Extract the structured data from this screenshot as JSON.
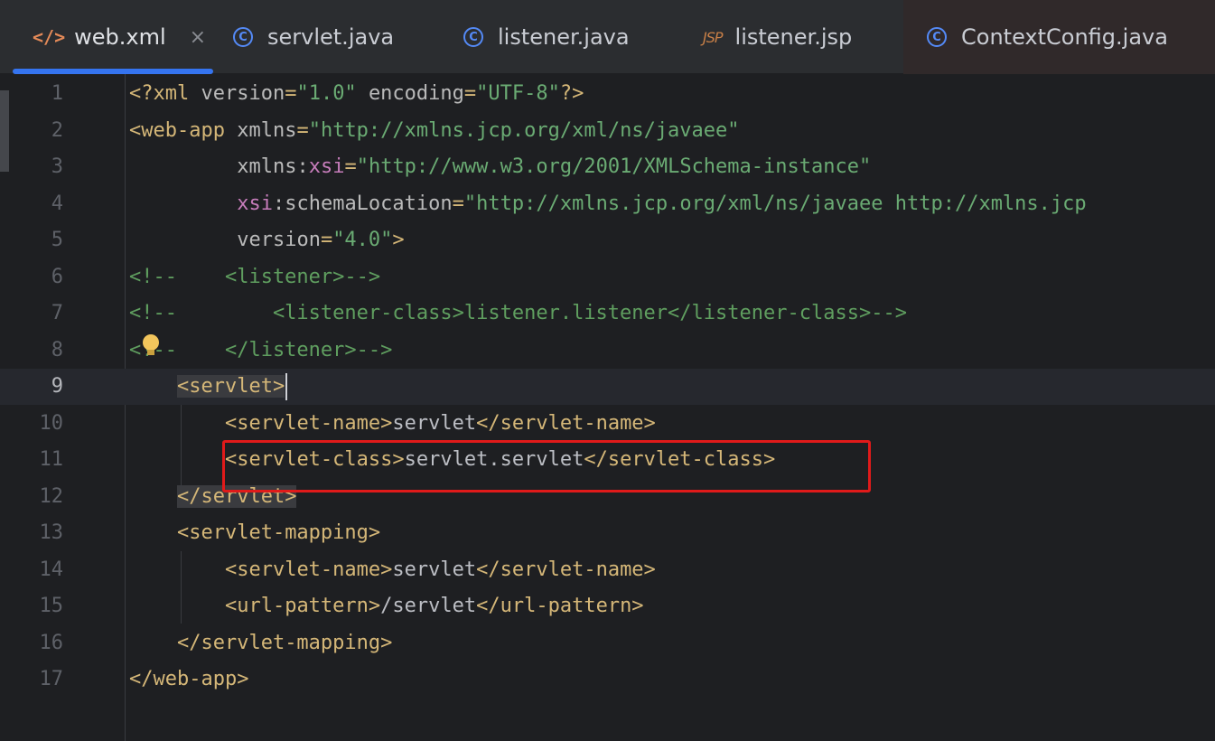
{
  "tabs": [
    {
      "label": "web.xml",
      "icon": "xml-file-icon",
      "active": true,
      "closable": true
    },
    {
      "label": "servlet.java",
      "icon": "java-class-icon",
      "active": false
    },
    {
      "label": "listener.java",
      "icon": "java-class-icon",
      "active": false
    },
    {
      "label": "listener.jsp",
      "icon": "jsp-file-icon",
      "icon_text": "JSP",
      "active": false
    },
    {
      "label": "ContextConfig.java",
      "icon": "java-class-icon",
      "active": false
    }
  ],
  "tab_close_glyph": "×",
  "java_icon_glyph": "C",
  "xml_icon_glyph": "</>",
  "editor": {
    "current_line": 9,
    "line_numbers": [
      "1",
      "2",
      "3",
      "4",
      "5",
      "6",
      "7",
      "8",
      "9",
      "10",
      "11",
      "12",
      "13",
      "14",
      "15",
      "16",
      "17"
    ],
    "lines": [
      [
        [
          "tag",
          "<?xml "
        ],
        [
          "an",
          "version"
        ],
        [
          "tag",
          "="
        ],
        [
          "av",
          "\"1.0\""
        ],
        [
          "tag",
          " "
        ],
        [
          "an",
          "encoding"
        ],
        [
          "tag",
          "="
        ],
        [
          "av",
          "\"UTF-8\""
        ],
        [
          "tag",
          "?>"
        ]
      ],
      [
        [
          "tag",
          "<web-app "
        ],
        [
          "an",
          "xmlns"
        ],
        [
          "tag",
          "="
        ],
        [
          "av",
          "\"http://xmlns.jcp.org/xml/ns/javaee\""
        ]
      ],
      [
        [
          "tx",
          "         "
        ],
        [
          "an",
          "xmlns:"
        ],
        [
          "ns",
          "xsi"
        ],
        [
          "tag",
          "="
        ],
        [
          "av",
          "\"http://www.w3.org/2001/XMLSchema-instance\""
        ]
      ],
      [
        [
          "tx",
          "         "
        ],
        [
          "ns",
          "xsi"
        ],
        [
          "an",
          ":schemaLocation"
        ],
        [
          "tag",
          "="
        ],
        [
          "av",
          "\"http://xmlns.jcp.org/xml/ns/javaee http://xmlns.jcp"
        ]
      ],
      [
        [
          "tx",
          "         "
        ],
        [
          "an",
          "version"
        ],
        [
          "tag",
          "="
        ],
        [
          "av",
          "\"4.0\""
        ],
        [
          "tag",
          ">"
        ]
      ],
      [
        [
          "cm",
          "<!--    <listener>-->"
        ]
      ],
      [
        [
          "cm",
          "<!--        <listener-class>listener.listener</listener-class>-->"
        ]
      ],
      [
        [
          "cm",
          "<!--    </listener>-->"
        ]
      ],
      [
        [
          "tx",
          "    "
        ],
        [
          "tag hl",
          "<servlet>"
        ]
      ],
      [
        [
          "tx",
          "        "
        ],
        [
          "tag",
          "<servlet-name>"
        ],
        [
          "tx",
          "servlet"
        ],
        [
          "tag",
          "</servlet-name>"
        ]
      ],
      [
        [
          "tx",
          "        "
        ],
        [
          "tag",
          "<servlet-class>"
        ],
        [
          "tx",
          "servlet.servlet"
        ],
        [
          "tag",
          "</servlet-class>"
        ]
      ],
      [
        [
          "tx",
          "    "
        ],
        [
          "tag hl",
          "</servlet>"
        ]
      ],
      [
        [
          "tx",
          "    "
        ],
        [
          "tag",
          "<servlet-mapping>"
        ]
      ],
      [
        [
          "tx",
          "        "
        ],
        [
          "tag",
          "<servlet-name>"
        ],
        [
          "tx",
          "servlet"
        ],
        [
          "tag",
          "</servlet-name>"
        ]
      ],
      [
        [
          "tx",
          "        "
        ],
        [
          "tag",
          "<url-pattern>"
        ],
        [
          "tx",
          "/servlet"
        ],
        [
          "tag",
          "</url-pattern>"
        ]
      ],
      [
        [
          "tx",
          "    "
        ],
        [
          "tag",
          "</servlet-mapping>"
        ]
      ],
      [
        [
          "tag",
          "</web-app>"
        ]
      ]
    ]
  },
  "highlight": {
    "line": 11,
    "color": "#e01a1a"
  },
  "colors": {
    "background": "#1e1f22",
    "tag": "#d5b778",
    "attribute_value": "#6aab73",
    "comment": "#5f9e5f",
    "namespace": "#c77dbb",
    "accent": "#3574f0"
  }
}
